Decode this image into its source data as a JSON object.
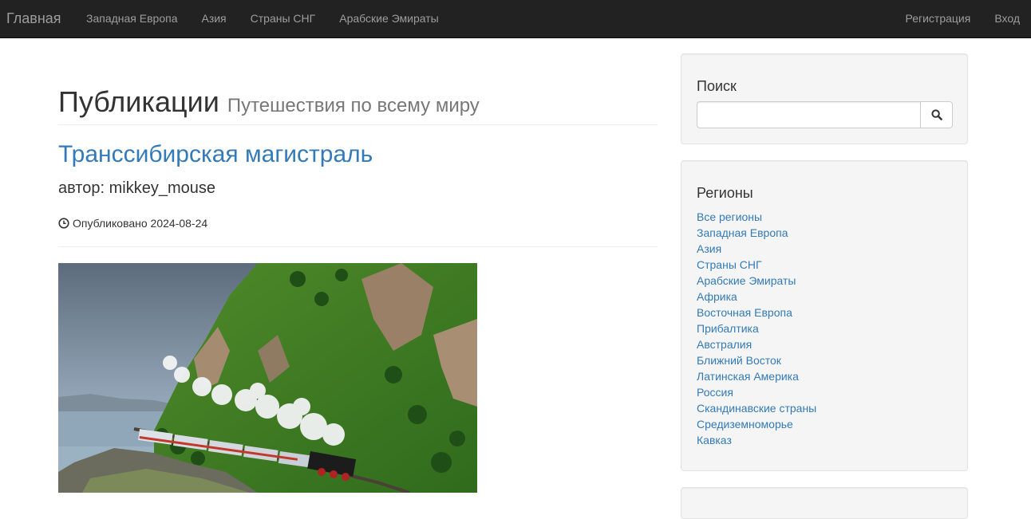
{
  "navbar": {
    "brand": "Главная",
    "left_links": [
      {
        "label": "Западная Европа"
      },
      {
        "label": "Азия"
      },
      {
        "label": "Страны СНГ"
      },
      {
        "label": "Арабские Эмираты"
      }
    ],
    "right_links": [
      {
        "label": "Регистрация"
      },
      {
        "label": "Вход"
      }
    ]
  },
  "main": {
    "heading": "Публикации",
    "subheading": "Путешествия по всему миру",
    "post": {
      "title": "Транссибирская магистраль",
      "author": "автор: mikkey_mouse",
      "published": "Опубликовано 2024-08-24",
      "image_icon": "photo-train-landscape"
    }
  },
  "sidebar": {
    "search": {
      "title": "Поиск",
      "placeholder": "",
      "value": "",
      "button_icon": "search-icon"
    },
    "regions": {
      "title": "Регионы",
      "items": [
        {
          "label": "Все регионы"
        },
        {
          "label": "Западная Европа"
        },
        {
          "label": "Азия"
        },
        {
          "label": "Страны СНГ"
        },
        {
          "label": "Арабские Эмираты"
        },
        {
          "label": "Африка"
        },
        {
          "label": "Восточная Европа"
        },
        {
          "label": "Прибалтика"
        },
        {
          "label": "Австралия"
        },
        {
          "label": "Ближний Восток"
        },
        {
          "label": "Латинская Америка"
        },
        {
          "label": "Россия"
        },
        {
          "label": "Скандинавские страны"
        },
        {
          "label": "Средиземноморье"
        },
        {
          "label": "Кавказ"
        }
      ]
    }
  },
  "colors": {
    "navbar_bg": "#222222",
    "nav_text": "#9d9d9d",
    "link": "#337ab7",
    "well_bg": "#f5f5f5"
  }
}
